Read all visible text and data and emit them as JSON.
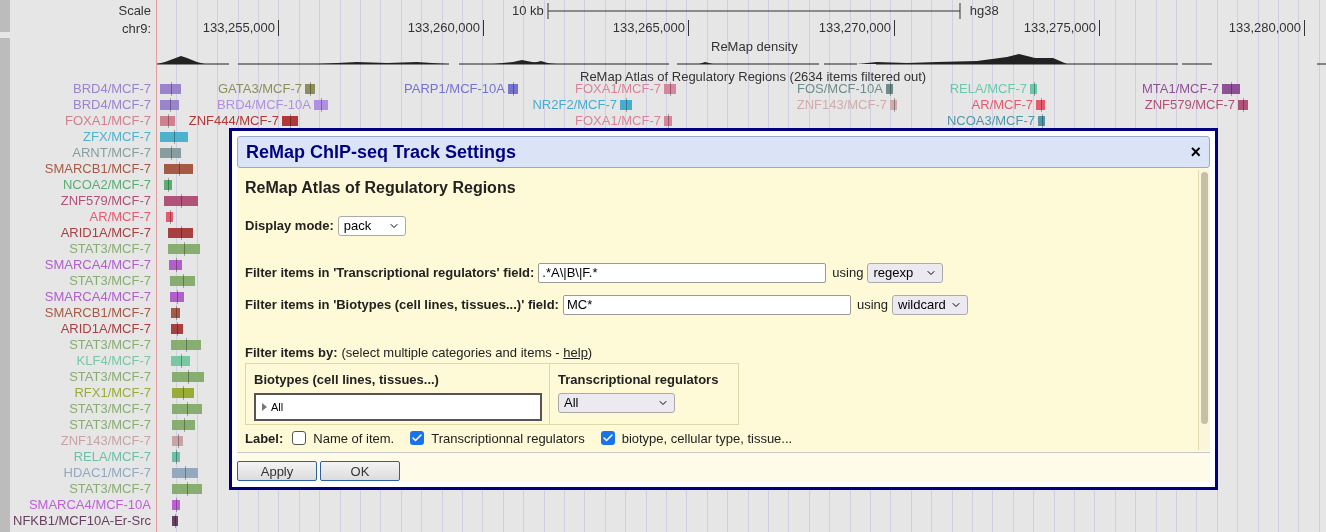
{
  "scale": {
    "label": "Scale",
    "size": "10 kb",
    "assembly": "hg38"
  },
  "position": {
    "label": "chr9:",
    "ticks": [
      "133,255,000",
      "133,260,000",
      "133,265,000",
      "133,270,000",
      "133,275,000",
      "133,280,000"
    ]
  },
  "density_track": {
    "title": "ReMap density"
  },
  "atlas_track": {
    "title": "ReMap Atlas of Regulatory Regions (2634 items filtered out)",
    "rows": [
      {
        "label": "BRD4/MCF-7",
        "color": "#9a84cc"
      },
      {
        "label": "BRD4/MCF-7",
        "color": "#9a84cc"
      },
      {
        "label": "FOXA1/MCF-7",
        "color": "#d0808f"
      },
      {
        "label": "ZFX/MCF-7",
        "color": "#4fb2cc"
      },
      {
        "label": "ARNT/MCF-7",
        "color": "#889e9e"
      },
      {
        "label": "SMARCB1/MCF-7",
        "color": "#a65a45"
      },
      {
        "label": "NCOA2/MCF-7",
        "color": "#5aae74"
      },
      {
        "label": "ZNF579/MCF-7",
        "color": "#b0527a"
      },
      {
        "label": "AR/MCF-7",
        "color": "#e55a6e"
      },
      {
        "label": "ARID1A/MCF-7",
        "color": "#a84040"
      },
      {
        "label": "STAT3/MCF-7",
        "color": "#88ad70"
      },
      {
        "label": "SMARCA4/MCF-7",
        "color": "#b060c8"
      },
      {
        "label": "STAT3/MCF-7",
        "color": "#88ad70"
      },
      {
        "label": "SMARCA4/MCF-7",
        "color": "#b060c8"
      },
      {
        "label": "SMARCB1/MCF-7",
        "color": "#a65a45"
      },
      {
        "label": "ARID1A/MCF-7",
        "color": "#a84040"
      },
      {
        "label": "STAT3/MCF-7",
        "color": "#88ad70"
      },
      {
        "label": "KLF4/MCF-7",
        "color": "#78c8a4"
      },
      {
        "label": "STAT3/MCF-7",
        "color": "#88ad70"
      },
      {
        "label": "RFX1/MCF-7",
        "color": "#9aac38"
      },
      {
        "label": "STAT3/MCF-7",
        "color": "#88ad70"
      },
      {
        "label": "STAT3/MCF-7",
        "color": "#88ad70"
      },
      {
        "label": "ZNF143/MCF-7",
        "color": "#c8a4a4"
      },
      {
        "label": "RELA/MCF-7",
        "color": "#6cc0a8"
      },
      {
        "label": "HDAC1/MCF-7",
        "color": "#94a8c0"
      },
      {
        "label": "STAT3/MCF-7",
        "color": "#88ad70"
      },
      {
        "label": "SMARCA4/MCF-10A",
        "color": "#c060d8"
      },
      {
        "label": "NFKB1/MCF10A-Er-Src",
        "color": "#684060"
      }
    ],
    "inline_items": [
      {
        "label": "GATA3/MCF-7",
        "color": "#8e8e5c"
      },
      {
        "label": "PARP1/MCF-10A",
        "color": "#7474d0"
      },
      {
        "label": "FOXA1/MCF-7",
        "color": "#d8849c"
      },
      {
        "label": "FOS/MCF-10A",
        "color": "#6e8c8c"
      },
      {
        "label": "RELA/MCF-7",
        "color": "#6cc8ac"
      },
      {
        "label": "MTA1/MCF-7",
        "color": "#905098"
      },
      {
        "label": "BRD4/MCF-10A",
        "color": "#b090e0"
      },
      {
        "label": "NR2F2/MCF-7",
        "color": "#48acd0"
      },
      {
        "label": "ZNF143/MCF-7",
        "color": "#d0acac"
      },
      {
        "label": "AR/MCF-7",
        "color": "#e55a6e"
      },
      {
        "label": "ZNF579/MCF-7",
        "color": "#b0527a"
      },
      {
        "label": "ZNF444/MCF-7",
        "color": "#b03838"
      },
      {
        "label": "FOXA1/MCF-7",
        "color": "#d8849c"
      },
      {
        "label": "NCOA3/MCF-7",
        "color": "#5296a8"
      }
    ]
  },
  "dialog": {
    "title": "ReMap ChIP-seq Track Settings",
    "close": "×",
    "heading": "ReMap Atlas of Regulatory Regions",
    "display_mode": {
      "label": "Display mode:",
      "value": "pack"
    },
    "filters": [
      {
        "label": "Filter items in 'Transcriptional regulators' field:",
        "value": ".*A\\|B\\|F.*",
        "using": "using",
        "match": "regexp"
      },
      {
        "label": "Filter items in 'Biotypes (cell lines, tissues...)' field:",
        "value": "MC*",
        "using": "using",
        "match": "wildcard"
      }
    ],
    "filter_by": {
      "label": "Filter items by:",
      "note": "(select multiple categories and items - ",
      "link": "help",
      "note_end": ")"
    },
    "categories": [
      {
        "title": "Biotypes (cell lines, tissues...)",
        "kind": "tree",
        "value": "All",
        "expanded": false
      },
      {
        "title": "Transcriptional regulators",
        "kind": "select",
        "value": "All"
      }
    ],
    "label_options": {
      "label": "Label:",
      "options": [
        {
          "text": "Name of item.",
          "checked": false
        },
        {
          "text": "Transcriptionnal regulators",
          "checked": true
        },
        {
          "text": "biotype, cellular type, tissue...",
          "checked": true
        }
      ]
    },
    "buttons": [
      "Apply",
      "OK"
    ]
  }
}
